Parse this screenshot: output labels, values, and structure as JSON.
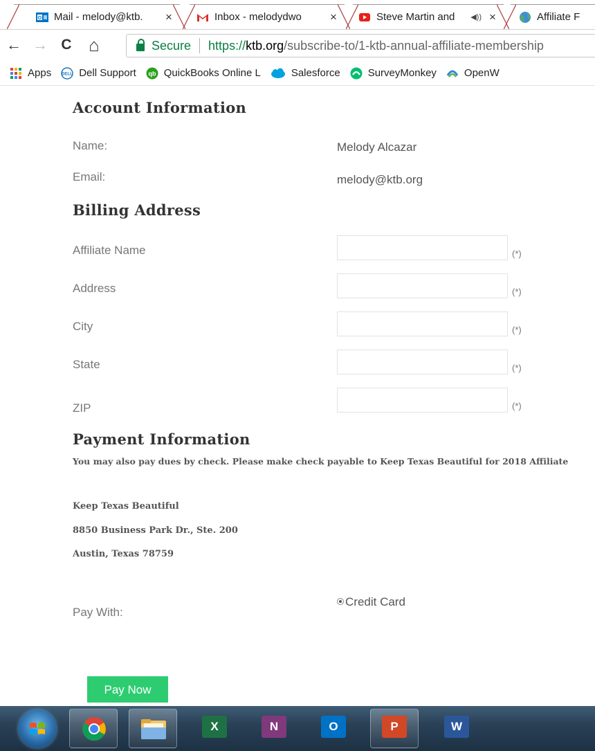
{
  "tabs": [
    {
      "title": "Mail - melody@ktb.",
      "close": "×",
      "icon": "outlook-icon"
    },
    {
      "title": "Inbox - melodydwo",
      "close": "×",
      "icon": "gmail-icon"
    },
    {
      "title": "Steve Martin and",
      "close": "×",
      "icon": "youtube-icon",
      "audio": "◀))"
    },
    {
      "title": "Affiliate F",
      "icon": "globe-icon"
    }
  ],
  "toolbar": {
    "back": "←",
    "forward": "→",
    "reload": "C",
    "home": "⌂",
    "secure_label": "Secure",
    "url_scheme": "https://",
    "url_host": "ktb.org",
    "url_path": "/subscribe-to/1-ktb-annual-affiliate-membership"
  },
  "bookmarks": [
    {
      "label": "Apps",
      "icon": "apps-grid-icon"
    },
    {
      "label": "Dell Support",
      "icon": "dell-icon"
    },
    {
      "label": "QuickBooks Online L",
      "icon": "quickbooks-icon"
    },
    {
      "label": "Salesforce",
      "icon": "salesforce-icon"
    },
    {
      "label": "SurveyMonkey",
      "icon": "surveymonkey-icon"
    },
    {
      "label": "OpenW",
      "icon": "openw-icon"
    }
  ],
  "account": {
    "heading": "Account Information",
    "name_label": "Name:",
    "name_value": "Melody Alcazar",
    "email_label": "Email:",
    "email_value": "melody@ktb.org"
  },
  "billing": {
    "heading": "Billing Address",
    "required_marker": "(*)",
    "fields": [
      {
        "label": "Affiliate Name",
        "value": ""
      },
      {
        "label": "Address",
        "value": ""
      },
      {
        "label": "City",
        "value": ""
      },
      {
        "label": "State",
        "value": ""
      },
      {
        "label": "ZIP",
        "value": ""
      }
    ]
  },
  "payment": {
    "heading": "Payment Information",
    "note": "You may also pay dues by check. Please make check payable to Keep Texas Beautiful for 2018 Affiliate",
    "address_lines": [
      "Keep Texas Beautiful",
      "8850 Business Park Dr., Ste. 200",
      "Austin, Texas 78759"
    ],
    "pay_with_label": "Pay With:",
    "option_label": "Credit Card",
    "pay_button": "Pay Now"
  },
  "taskbar": {
    "apps": [
      {
        "name": "chrome",
        "letter": ""
      },
      {
        "name": "file-explorer",
        "letter": ""
      },
      {
        "name": "excel",
        "letter": "X",
        "color": "#1e7145"
      },
      {
        "name": "onenote",
        "letter": "N",
        "color": "#80397b"
      },
      {
        "name": "outlook",
        "letter": "O",
        "color": "#0072c6"
      },
      {
        "name": "powerpoint",
        "letter": "P",
        "color": "#d24726"
      },
      {
        "name": "word",
        "letter": "W",
        "color": "#2b579a"
      }
    ]
  },
  "colors": {
    "accent_green": "#2ecc71",
    "secure_green": "#0b8043"
  }
}
